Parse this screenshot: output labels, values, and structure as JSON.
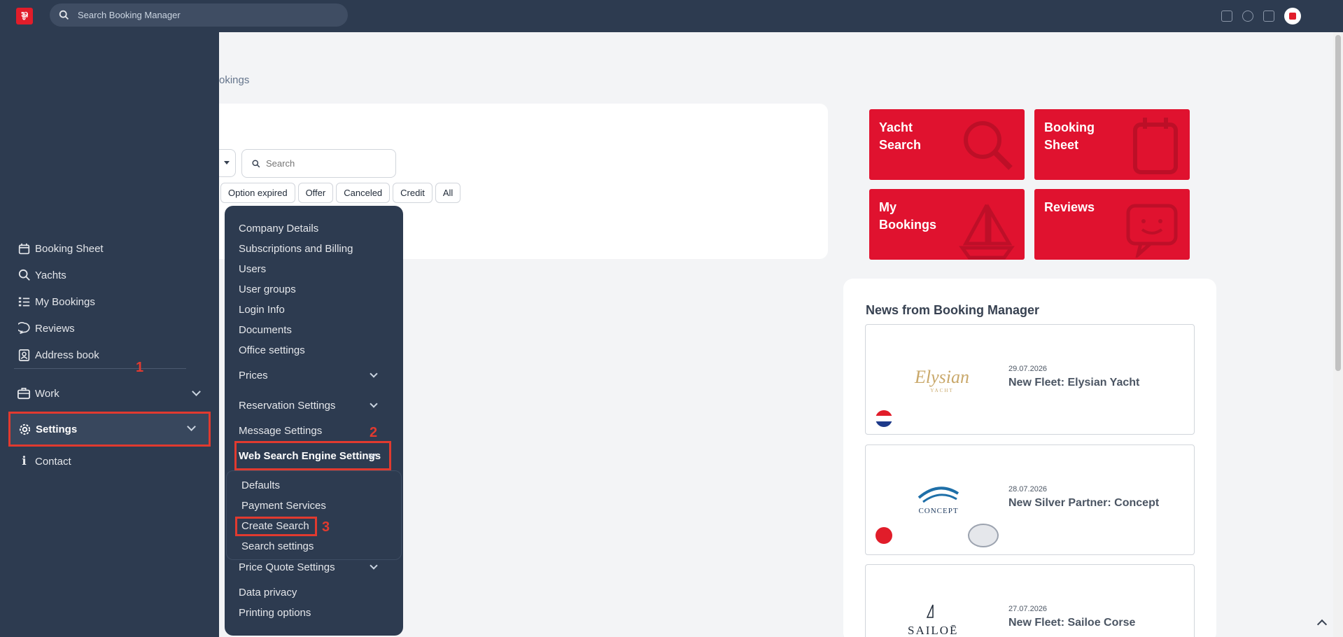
{
  "topbar": {
    "search_placeholder": "Search Booking Manager"
  },
  "sidebar": {
    "items": [
      {
        "label": "Booking Sheet",
        "icon": "calendar-icon"
      },
      {
        "label": "Yachts",
        "icon": "search-icon"
      },
      {
        "label": "My Bookings",
        "icon": "list-icon"
      },
      {
        "label": "Reviews",
        "icon": "chat-icon"
      },
      {
        "label": "Address book",
        "icon": "contact-book-icon"
      }
    ],
    "work_label": "Work",
    "settings_label": "Settings",
    "contact_label": "Contact"
  },
  "annotations": {
    "one": "1",
    "two": "2",
    "three": "3"
  },
  "main": {
    "breadcrumb": "okings",
    "search_placeholder": "Search",
    "filter_chips": [
      "Option expired",
      "Offer",
      "Canceled",
      "Credit",
      "All"
    ]
  },
  "settings_menu": {
    "items": [
      "Company Details",
      "Subscriptions and Billing",
      "Users",
      "User groups",
      "Login Info",
      "Documents",
      "Office settings"
    ],
    "prices": "Prices",
    "reservation_settings": "Reservation Settings",
    "message_settings": "Message Settings",
    "web_search_engine_settings": "Web Search Engine Settings",
    "sub_items": [
      "Defaults",
      "Payment Services",
      "Create Search",
      "Search settings"
    ],
    "price_quote_settings": "Price Quote Settings",
    "data_privacy": "Data privacy",
    "printing_options": "Printing options"
  },
  "tiles": [
    {
      "line1": "Yacht",
      "line2": "Search"
    },
    {
      "line1": "Booking",
      "line2": "Sheet"
    },
    {
      "line1": "My",
      "line2": "Bookings"
    },
    {
      "line1": "Reviews",
      "line2": ""
    }
  ],
  "news": {
    "heading": "News from Booking Manager",
    "items": [
      {
        "date": "29.07.2026",
        "title": "New Fleet: Elysian Yacht",
        "logo": "Elysian",
        "logo_sub": "YACHT"
      },
      {
        "date": "28.07.2026",
        "title": "New Silver Partner: Concept",
        "logo": "CONCEPT"
      },
      {
        "date": "27.07.2026",
        "title": "New Fleet: Sailoe Corse",
        "logo": "SAILOĒ"
      }
    ]
  },
  "colors": {
    "sidebar": "#2d3b50",
    "brand_red": "#e0122f",
    "annotation": "#e13a2f"
  }
}
